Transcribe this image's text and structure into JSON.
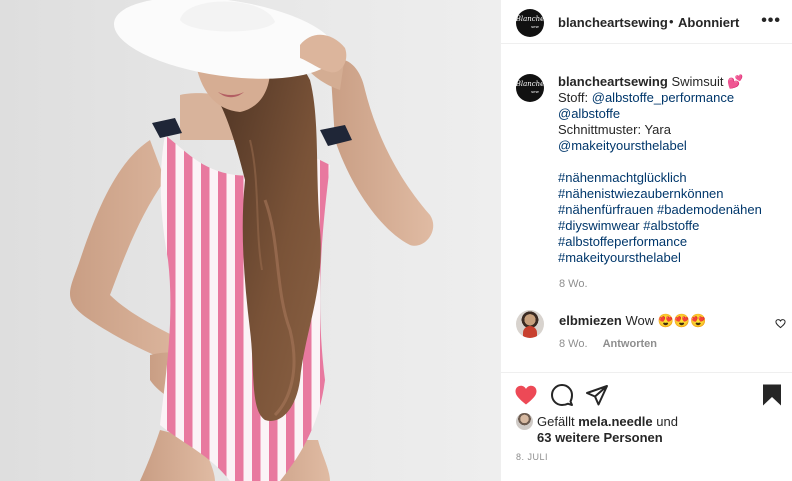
{
  "header": {
    "avatar_text": "Blanche",
    "avatar_sub": "sew",
    "username": "blancheartsewing",
    "separator": "•",
    "follow_status": "Abonniert",
    "more": "•••"
  },
  "caption": {
    "username": "blancheartsewing",
    "title": "Swimsuit 💕",
    "fabric_label": "Stoff:",
    "fabric_link_1": "@albstoffe_performance",
    "fabric_link_2": "@albstoffe",
    "pattern_label": "Schnittmuster: Yara",
    "pattern_link": "@makeityoursthelabel",
    "hashtags": [
      "#nähenmachtglücklich",
      "#nähenistwiezaubernkönnen",
      "#nähenfürfrauen #bademodenähen",
      "#diyswimwear #albstoffe",
      "#albstoffeperformance",
      "#makeityoursthelabel"
    ],
    "time": "8 Wo."
  },
  "comment": {
    "username": "elbmiezen",
    "text": "Wow 😍😍😍",
    "time": "8 Wo.",
    "reply_label": "Antworten"
  },
  "actions": {
    "liked": true,
    "like_color": "#ed4956",
    "likes_prefix": "Gefällt",
    "likes_user": "mela.needle",
    "likes_and": "und",
    "likes_others": "63 weitere Personen",
    "date": "8. JULI"
  }
}
